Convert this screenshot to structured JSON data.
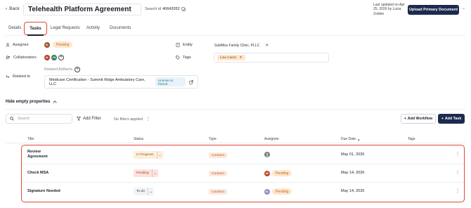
{
  "header": {
    "back_label": "Back",
    "title": "Telehealth Platform Agreement",
    "search_id_label": "Search id",
    "search_id_value": "40642052",
    "updated_text": "Last updated on Apr 25, 2026 by Luiza Zolden",
    "upload_label": "Upload Primary Document",
    "more_label": "···"
  },
  "tabs": [
    {
      "label": "Details"
    },
    {
      "label": "Tasks"
    },
    {
      "label": "Legal Requests"
    },
    {
      "label": "Activity"
    },
    {
      "label": "Documents"
    }
  ],
  "properties": {
    "assignee_label": "Assignee",
    "assignee_avatar": "SL",
    "assignee_status": "Pending",
    "collaborators_label": "Collaborators",
    "collab_avatars": [
      "AL",
      "JW"
    ],
    "related_label": "Related to",
    "entity_label": "Entity",
    "entity_value": "SubMiss Family Clinic, PLLC",
    "tags_label": "Tags",
    "tag_value": "Lisa Carter",
    "artifacts_label": "Related Artifacts",
    "artifact_name": "Medicare Certification - Summit Ridge Ambulatory Care, LLC",
    "artifact_type": "License or Permit"
  },
  "hide_props_label": "Hide empty properties",
  "filters": {
    "search_placeholder": "Search",
    "add_filter_label": "Add Filter",
    "no_filters_label": "No filters applied",
    "add_workflow_label": "Add Workflow",
    "add_task_label": "Add Task"
  },
  "table": {
    "headers": [
      "Title",
      "Status",
      "Type",
      "Assignee",
      "Due Date",
      "Tags"
    ],
    "rows": [
      {
        "title": "Review Agreement",
        "status": "In Progress",
        "type": "Contract",
        "assignee_avatar": "",
        "assignee_status": "",
        "due": "May 01, 2026"
      },
      {
        "title": "Check MSA",
        "status": "Pending",
        "type": "Contract",
        "assignee_avatar": "AF",
        "assignee_status": "Pending",
        "due": "May 14, 2026"
      },
      {
        "title": "Signature Needed",
        "status": "To do",
        "type": "Contract",
        "assignee_avatar": "PL",
        "assignee_status": "Pending",
        "due": "May 14, 2026"
      }
    ]
  },
  "colors": {
    "primary": "#1d2a4d",
    "highlight": "#e4463a",
    "pending_bg": "#fde7cf",
    "contract_bg": "#fde9dd"
  }
}
